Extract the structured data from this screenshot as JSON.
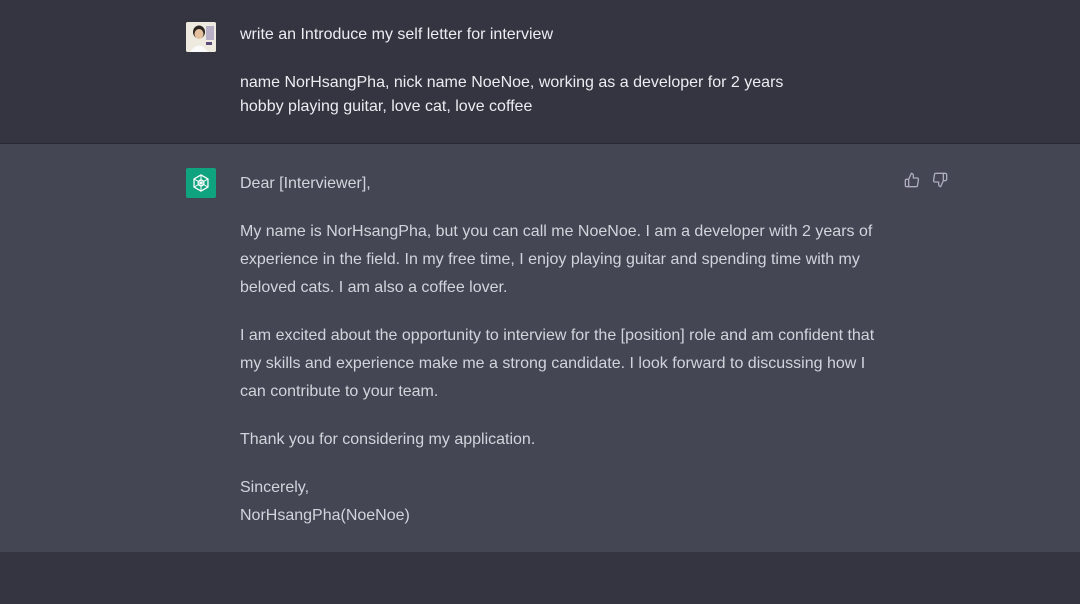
{
  "conversation": {
    "user_message": {
      "line1": "write an Introduce my self letter for interview",
      "line2": "name NorHsangPha, nick name NoeNoe, working as a developer for 2 years",
      "line3": "hobby playing guitar, love cat, love coffee"
    },
    "assistant_message": {
      "greeting": "Dear [Interviewer],",
      "paragraph1": "My name is NorHsangPha, but you can call me NoeNoe. I am a developer with 2 years of experience in the field. In my free time, I enjoy playing guitar and spending time with my beloved cats. I am also a coffee lover.",
      "paragraph2": "I am excited about the opportunity to interview for the [position] role and am confident that my skills and experience make me a strong candidate. I look forward to discussing how I can contribute to your team.",
      "paragraph3": "Thank you for considering my application.",
      "closing": "Sincerely,",
      "signature": "NorHsangPha(NoeNoe)"
    },
    "feedback": {
      "thumbs_up_icon": "thumbs-up-icon",
      "thumbs_down_icon": "thumbs-down-icon"
    }
  },
  "colors": {
    "user_bg": "#343541",
    "assistant_bg": "#444654",
    "bot_avatar_bg": "#10a37f",
    "user_text": "#ececf1",
    "assistant_text": "#d1d5db"
  }
}
